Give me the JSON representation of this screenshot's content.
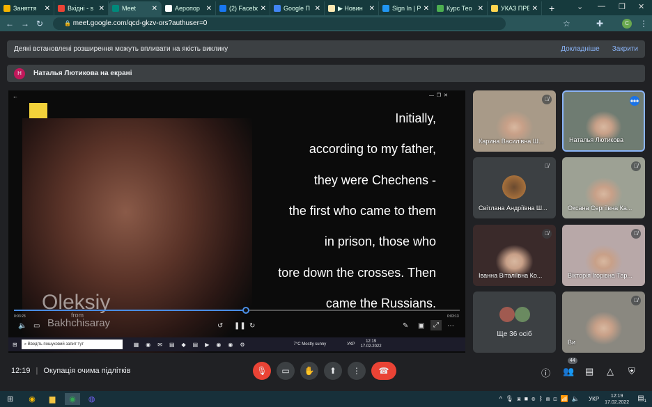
{
  "browser": {
    "tabs": [
      {
        "label": "Заняття",
        "color": "#f4b400"
      },
      {
        "label": "Вхідні - s",
        "color": "#ea4335"
      },
      {
        "label": "Meet",
        "color": "#00897b",
        "active": true
      },
      {
        "label": "Аеропор",
        "color": "#ffffff"
      },
      {
        "label": "(2) Facebo",
        "color": "#1877f2"
      },
      {
        "label": "Google П",
        "color": "#4285f4"
      },
      {
        "label": "▶ Новин",
        "color": "#fce8b2"
      },
      {
        "label": "Sign In | P",
        "color": "#2196f3"
      },
      {
        "label": "Курс Тео",
        "color": "#4caf50"
      },
      {
        "label": "УКАЗ ПРЕ",
        "color": "#ffd54f"
      }
    ],
    "new_tab": "+",
    "url": "meet.google.com/qcd-gkzv-ors?authuser=0",
    "profile": "C"
  },
  "banner": {
    "text": "Деякі встановлені розширення можуть впливати на якість виклику",
    "learn_more": "Докладніше",
    "close": "Закрити"
  },
  "presenting": {
    "initial": "Н",
    "text": "Наталья Лютикова на екрані"
  },
  "video": {
    "subtitles": [
      "Initially,",
      "according to my father,",
      "they were Chechens -",
      "the first who came to them",
      "in prison, those who",
      "tore down the crosses. Then",
      "came the Russians."
    ],
    "name_caption": "Oleksiy",
    "from": "from",
    "place": "Bakhchisaray",
    "time_elapsed": "0:03:23",
    "time_total": "0:03:13",
    "progress": 0.52,
    "taskbar": {
      "search": "Введіть пошуковий запит тут",
      "weather": "7°C  Mostly sunny",
      "lang": "УКР",
      "time": "12:19",
      "date": "17.02.2022"
    }
  },
  "participants": [
    {
      "name": "Карина Василівна Ш...",
      "muted": true,
      "bg": "#a89a88"
    },
    {
      "name": "Наталья Лютикова",
      "muted": false,
      "speaking": true,
      "bg": "#6f7c72"
    },
    {
      "name": "Світлана Андріївна Ш...",
      "muted": true,
      "avatar": true
    },
    {
      "name": "Оксана Сергіївна Ка...",
      "muted": true,
      "bg": "#9da194"
    },
    {
      "name": "Іванна Віталіївна Ко...",
      "muted": true,
      "bg": "#3a2a2a"
    },
    {
      "name": "Вікторія Ігорівна Тар...",
      "muted": true,
      "bg": "#b8a8a8"
    },
    {
      "name": "Ще 36 осіб",
      "more": true
    },
    {
      "name": "Ви",
      "muted": true,
      "bg": "#8a8880"
    }
  ],
  "bottom": {
    "time": "12:19",
    "separator": "|",
    "meeting": "Окупація очима підлітків",
    "people_count": "44"
  },
  "os": {
    "lang": "УКР",
    "time": "12:19",
    "date": "17.02.2022",
    "notif": "1"
  }
}
